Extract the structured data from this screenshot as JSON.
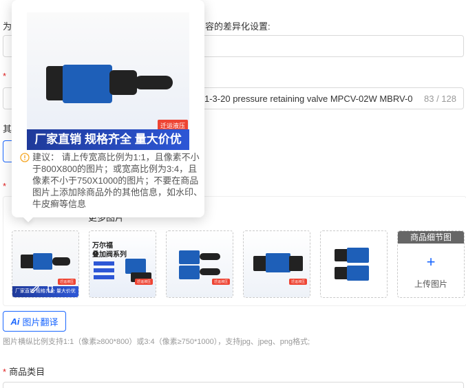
{
  "form": {
    "diff_label_prefix": "为",
    "diff_label_suffix": "容的差异化设置:",
    "title_required_mark": "*",
    "title_value": "1-3-20 pressure retaining valve MPCV-02W MBRV-0",
    "title_counter": "83 / 128",
    "other_label": "其",
    "category_label": "商品类目",
    "category_required_mark": "*"
  },
  "images": {
    "more_images_label": "更多图片",
    "detail_image_label": "商品细节图",
    "upload_label": "上传图片",
    "upload_plus": "+",
    "translate_button": "图片翻译",
    "translate_ai": "Ai",
    "hint": "图片横纵比例支持1:1（像素≥800*800）或3:4（像素≥750*1000），支持jpg、jpeg、png格式;",
    "thumbnails": [
      {
        "banner": "厂家直销 规格齐全 量大价优",
        "tag": "迁运液压"
      },
      {
        "title1": "万尔福",
        "title2": "叠加阀系列",
        "tag": "迁运液压"
      },
      {
        "banner": "",
        "tag": "迁运液压"
      },
      {
        "banner": "",
        "tag": "迁运液压"
      },
      {
        "banner": "",
        "tag": ""
      }
    ]
  },
  "popover": {
    "banner": "厂家直销 规格齐全 量大价优",
    "tag": "迁运液压",
    "tip": "建议：  请上传宽高比例为1:1，且像素不小于800X800的图片；或宽高比例为3:4，且像素不小于750X1000的图片；不要在商品图片上添加除商品外的其他信息，如水印、牛皮癣等信息"
  },
  "colors": {
    "accent": "#1966ff",
    "required": "#e02020",
    "banner": "#2448b8"
  }
}
